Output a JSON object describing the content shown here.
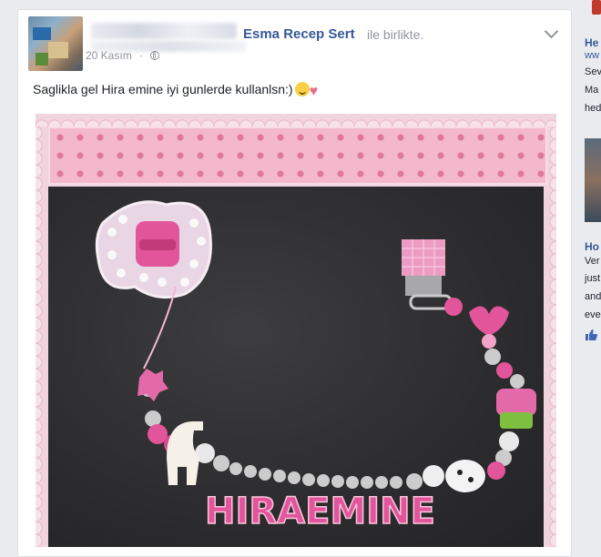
{
  "post": {
    "author": "Esma Recep Sert",
    "with_text": "ile birlikte.",
    "timestamp": "20 Kasım",
    "separator": "·",
    "message": "Saglikla gel Hira emine iyi gunlerde kullanlsn:)",
    "photo_caption_text": "HIRAEMINE"
  },
  "sidebar": {
    "title1": "He",
    "url": "ww",
    "line1": "Sev",
    "line2": "Ma",
    "line3": "hed",
    "title2": "Ho",
    "line4": "Ver",
    "line5": "just",
    "line6": "and",
    "line7": "eve"
  },
  "icons": {
    "privacy": "globe-icon",
    "options": "chevron-down-icon",
    "like": "thumbs-up-icon"
  },
  "colors": {
    "link": "#365899",
    "meta": "#90949c",
    "background": "#e9ebee"
  }
}
